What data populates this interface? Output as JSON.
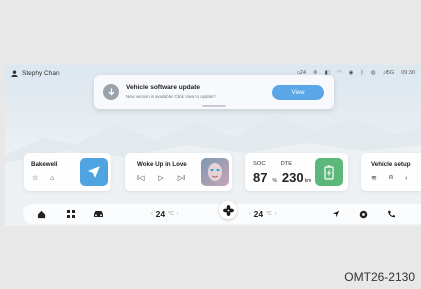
{
  "status": {
    "user": "Stephy Chan",
    "signal": ".ıl5G",
    "time": "09:30",
    "temp_small": "24"
  },
  "notification": {
    "title": "Vehicle software update",
    "subtitle": "New version is available! Click View to update?",
    "button": "View"
  },
  "cards": {
    "nav": {
      "title": "Bakewell"
    },
    "media": {
      "title": "Woke Up in Love"
    },
    "energy": {
      "soc_label": "SOC",
      "dte_label": "DTE",
      "soc_value": "87",
      "soc_unit": "%",
      "dte_value": "230",
      "dte_unit": "km"
    },
    "vehicle": {
      "title": "Vehicle setup"
    }
  },
  "dock": {
    "left_temp": "24",
    "right_temp": "24",
    "unit": "°C"
  },
  "footer": {
    "code": "OMT26-2130"
  },
  "colors": {
    "accent": "#5aa6e6",
    "nav_tile": "#4fa3e0",
    "battery_tile": "#5cb87a"
  }
}
